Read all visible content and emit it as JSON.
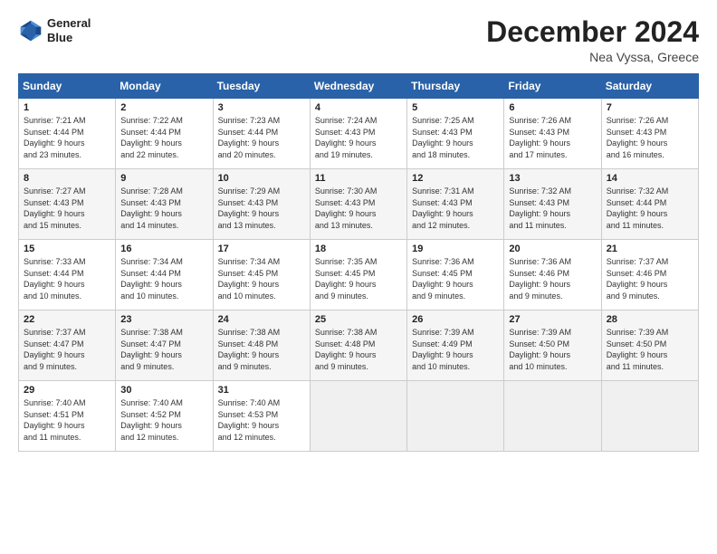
{
  "logo": {
    "line1": "General",
    "line2": "Blue"
  },
  "title": "December 2024",
  "subtitle": "Nea Vyssa, Greece",
  "days_of_week": [
    "Sunday",
    "Monday",
    "Tuesday",
    "Wednesday",
    "Thursday",
    "Friday",
    "Saturday"
  ],
  "weeks": [
    [
      {
        "day": 1,
        "info": "Sunrise: 7:21 AM\nSunset: 4:44 PM\nDaylight: 9 hours\nand 23 minutes."
      },
      {
        "day": 2,
        "info": "Sunrise: 7:22 AM\nSunset: 4:44 PM\nDaylight: 9 hours\nand 22 minutes."
      },
      {
        "day": 3,
        "info": "Sunrise: 7:23 AM\nSunset: 4:44 PM\nDaylight: 9 hours\nand 20 minutes."
      },
      {
        "day": 4,
        "info": "Sunrise: 7:24 AM\nSunset: 4:43 PM\nDaylight: 9 hours\nand 19 minutes."
      },
      {
        "day": 5,
        "info": "Sunrise: 7:25 AM\nSunset: 4:43 PM\nDaylight: 9 hours\nand 18 minutes."
      },
      {
        "day": 6,
        "info": "Sunrise: 7:26 AM\nSunset: 4:43 PM\nDaylight: 9 hours\nand 17 minutes."
      },
      {
        "day": 7,
        "info": "Sunrise: 7:26 AM\nSunset: 4:43 PM\nDaylight: 9 hours\nand 16 minutes."
      }
    ],
    [
      {
        "day": 8,
        "info": "Sunrise: 7:27 AM\nSunset: 4:43 PM\nDaylight: 9 hours\nand 15 minutes."
      },
      {
        "day": 9,
        "info": "Sunrise: 7:28 AM\nSunset: 4:43 PM\nDaylight: 9 hours\nand 14 minutes."
      },
      {
        "day": 10,
        "info": "Sunrise: 7:29 AM\nSunset: 4:43 PM\nDaylight: 9 hours\nand 13 minutes."
      },
      {
        "day": 11,
        "info": "Sunrise: 7:30 AM\nSunset: 4:43 PM\nDaylight: 9 hours\nand 13 minutes."
      },
      {
        "day": 12,
        "info": "Sunrise: 7:31 AM\nSunset: 4:43 PM\nDaylight: 9 hours\nand 12 minutes."
      },
      {
        "day": 13,
        "info": "Sunrise: 7:32 AM\nSunset: 4:43 PM\nDaylight: 9 hours\nand 11 minutes."
      },
      {
        "day": 14,
        "info": "Sunrise: 7:32 AM\nSunset: 4:44 PM\nDaylight: 9 hours\nand 11 minutes."
      }
    ],
    [
      {
        "day": 15,
        "info": "Sunrise: 7:33 AM\nSunset: 4:44 PM\nDaylight: 9 hours\nand 10 minutes."
      },
      {
        "day": 16,
        "info": "Sunrise: 7:34 AM\nSunset: 4:44 PM\nDaylight: 9 hours\nand 10 minutes."
      },
      {
        "day": 17,
        "info": "Sunrise: 7:34 AM\nSunset: 4:45 PM\nDaylight: 9 hours\nand 10 minutes."
      },
      {
        "day": 18,
        "info": "Sunrise: 7:35 AM\nSunset: 4:45 PM\nDaylight: 9 hours\nand 9 minutes."
      },
      {
        "day": 19,
        "info": "Sunrise: 7:36 AM\nSunset: 4:45 PM\nDaylight: 9 hours\nand 9 minutes."
      },
      {
        "day": 20,
        "info": "Sunrise: 7:36 AM\nSunset: 4:46 PM\nDaylight: 9 hours\nand 9 minutes."
      },
      {
        "day": 21,
        "info": "Sunrise: 7:37 AM\nSunset: 4:46 PM\nDaylight: 9 hours\nand 9 minutes."
      }
    ],
    [
      {
        "day": 22,
        "info": "Sunrise: 7:37 AM\nSunset: 4:47 PM\nDaylight: 9 hours\nand 9 minutes."
      },
      {
        "day": 23,
        "info": "Sunrise: 7:38 AM\nSunset: 4:47 PM\nDaylight: 9 hours\nand 9 minutes."
      },
      {
        "day": 24,
        "info": "Sunrise: 7:38 AM\nSunset: 4:48 PM\nDaylight: 9 hours\nand 9 minutes."
      },
      {
        "day": 25,
        "info": "Sunrise: 7:38 AM\nSunset: 4:48 PM\nDaylight: 9 hours\nand 9 minutes."
      },
      {
        "day": 26,
        "info": "Sunrise: 7:39 AM\nSunset: 4:49 PM\nDaylight: 9 hours\nand 10 minutes."
      },
      {
        "day": 27,
        "info": "Sunrise: 7:39 AM\nSunset: 4:50 PM\nDaylight: 9 hours\nand 10 minutes."
      },
      {
        "day": 28,
        "info": "Sunrise: 7:39 AM\nSunset: 4:50 PM\nDaylight: 9 hours\nand 11 minutes."
      }
    ],
    [
      {
        "day": 29,
        "info": "Sunrise: 7:40 AM\nSunset: 4:51 PM\nDaylight: 9 hours\nand 11 minutes."
      },
      {
        "day": 30,
        "info": "Sunrise: 7:40 AM\nSunset: 4:52 PM\nDaylight: 9 hours\nand 12 minutes."
      },
      {
        "day": 31,
        "info": "Sunrise: 7:40 AM\nSunset: 4:53 PM\nDaylight: 9 hours\nand 12 minutes."
      },
      null,
      null,
      null,
      null
    ]
  ]
}
